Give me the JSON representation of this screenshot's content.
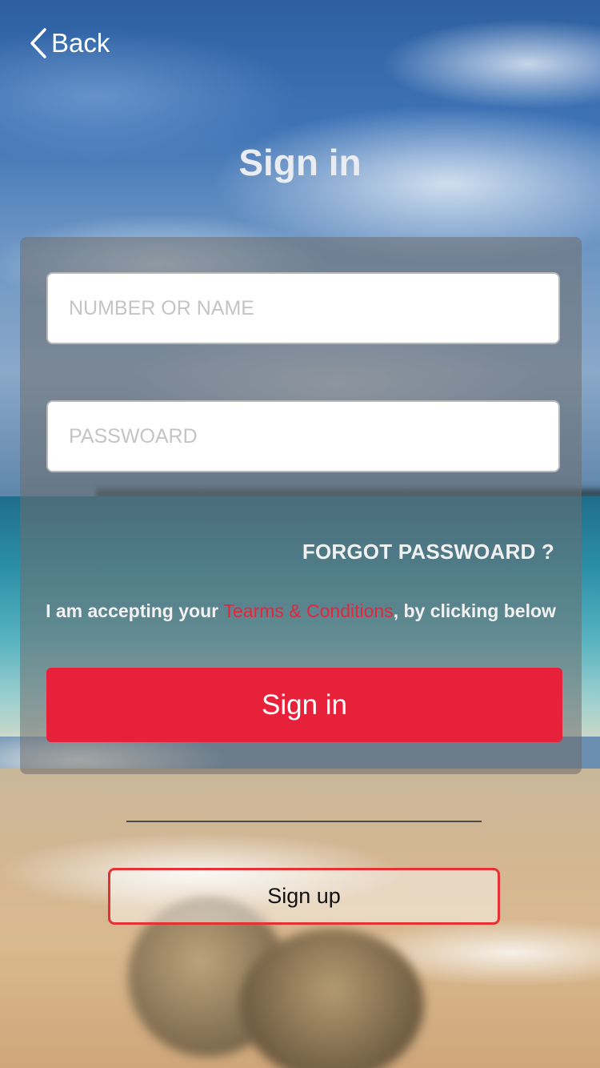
{
  "nav": {
    "back_label": "Back"
  },
  "header": {
    "title": "Sign in"
  },
  "form": {
    "username_placeholder": "NUMBER OR NAME",
    "username_value": "",
    "password_placeholder": "PASSWOARD",
    "password_value": "",
    "forgot_label": "FORGOT PASSWOARD ?",
    "terms_prefix": "I am accepting your ",
    "terms_link": "Tearms & Conditions",
    "terms_suffix": ", by clicking below",
    "signin_label": "Sign in"
  },
  "footer": {
    "signup_label": "Sign up"
  },
  "colors": {
    "accent": "#e8213a",
    "signup_border": "#e53131",
    "panel_overlay": "rgba(110,110,110,0.55)"
  },
  "icons": {
    "back": "chevron-left-icon"
  }
}
